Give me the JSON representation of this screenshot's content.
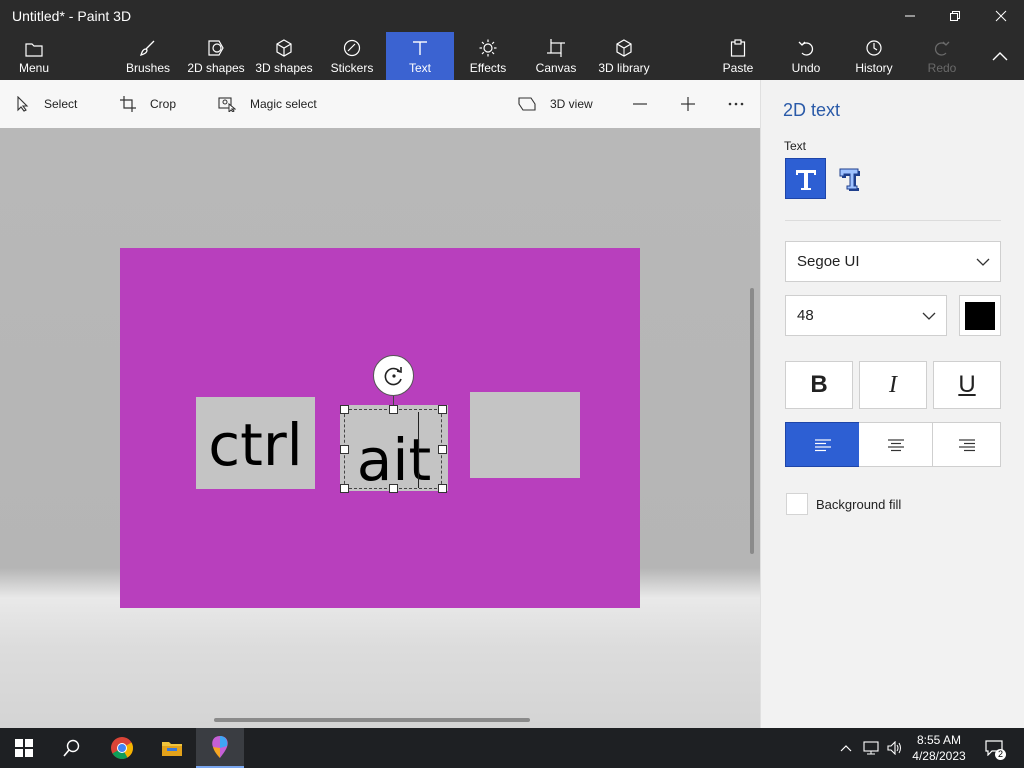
{
  "window": {
    "title": "Untitled* - Paint 3D"
  },
  "ribbon": {
    "menu": "Menu",
    "brushes": "Brushes",
    "shapes2d": "2D shapes",
    "shapes3d": "3D shapes",
    "stickers": "Stickers",
    "text": "Text",
    "effects": "Effects",
    "canvas": "Canvas",
    "library3d": "3D library",
    "paste": "Paste",
    "undo": "Undo",
    "history": "History",
    "redo": "Redo"
  },
  "toolbar": {
    "select": "Select",
    "crop": "Crop",
    "magic_select": "Magic select",
    "view3d": "3D view"
  },
  "canvas": {
    "color": "#b83fbd",
    "boxes": [
      "ctrl",
      "ait",
      ""
    ]
  },
  "panel": {
    "title": "2D text",
    "text_label": "Text",
    "font": "Segoe UI",
    "size": "48",
    "text_color": "#000000",
    "bold": "B",
    "italic": "I",
    "underline": "U",
    "alignment": "left",
    "background_fill_label": "Background fill",
    "background_fill_checked": false
  },
  "taskbar": {
    "time": "8:55 AM",
    "date": "4/28/2023",
    "notifications": "2"
  },
  "colors": {
    "accent": "#3b63d1",
    "chrome": "#2b2b2b"
  }
}
